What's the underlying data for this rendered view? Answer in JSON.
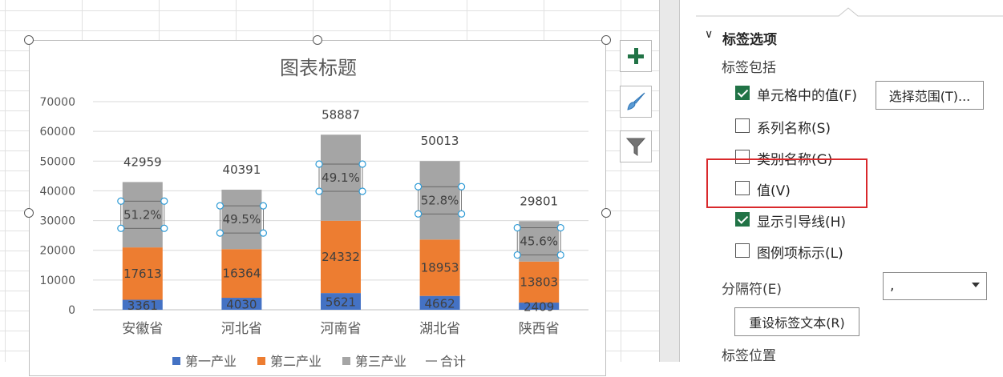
{
  "chart_data": {
    "type": "bar",
    "stacked": true,
    "title": "图表标题",
    "categories": [
      "安徽省",
      "河北省",
      "河南省",
      "湖北省",
      "陕西省"
    ],
    "series": [
      {
        "name": "第一产业",
        "color": "#4472c4",
        "values": [
          3361,
          4030,
          5621,
          4662,
          2409
        ]
      },
      {
        "name": "第二产业",
        "color": "#ed7d31",
        "values": [
          17613,
          16364,
          24332,
          18953,
          13803
        ]
      },
      {
        "name": "第三产业",
        "color": "#a5a5a5",
        "values": [
          21985,
          19997,
          28934,
          26398,
          13589
        ]
      },
      {
        "name": "合计",
        "color": "#000000",
        "values": [
          42959,
          40391,
          58887,
          50013,
          29801
        ]
      }
    ],
    "third_labels": [
      "51.2%",
      "49.5%",
      "49.1%",
      "52.8%",
      "45.6%"
    ],
    "totals": [
      "42959",
      "40391",
      "58887",
      "50013",
      "29801"
    ],
    "seg1_labels": [
      "3361",
      "4030",
      "5621",
      "4662",
      "2409"
    ],
    "seg2_labels": [
      "17613",
      "16364",
      "24332",
      "18953",
      "13803"
    ],
    "ylim": [
      0,
      70000
    ],
    "yticks": [
      "0",
      "10000",
      "20000",
      "30000",
      "40000",
      "50000",
      "60000",
      "70000"
    ],
    "grid": true,
    "legend": "bottom"
  },
  "panel": {
    "section_title": "标签选项",
    "label_includes": "标签包括",
    "options": [
      {
        "label": "单元格中的值(F)",
        "checked": true
      },
      {
        "label": "系列名称(S)",
        "checked": false
      },
      {
        "label": "类别名称(G)",
        "checked": false
      },
      {
        "label": "值(V)",
        "checked": false
      },
      {
        "label": "显示引导线(H)",
        "checked": true
      },
      {
        "label": "图例项标示(L)",
        "checked": false
      }
    ],
    "select_range_button": "选择范围(T)...",
    "separator_label": "分隔符(E)",
    "separator_value": ",",
    "reset_button": "重设标签文本(R)",
    "label_position": "标签位置"
  },
  "side_buttons": [
    "plus-icon",
    "brush-icon",
    "filter-icon"
  ],
  "colors": {
    "accent": "#217346",
    "highlight_box": "#d9292c"
  }
}
